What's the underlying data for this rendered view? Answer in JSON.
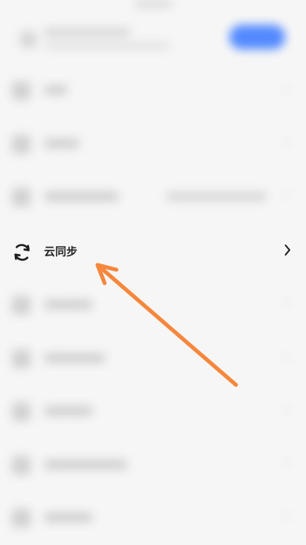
{
  "screen": {
    "highlighted_item": {
      "label": "云同步",
      "icon": "sync-icon",
      "chevron_icon": "chevron-right-icon"
    },
    "annotation": {
      "type": "arrow",
      "color": "#F6873C"
    },
    "colors": {
      "accent_button": "#4A84FF",
      "background": "#F6F6F6",
      "text_primary": "#222222"
    }
  }
}
